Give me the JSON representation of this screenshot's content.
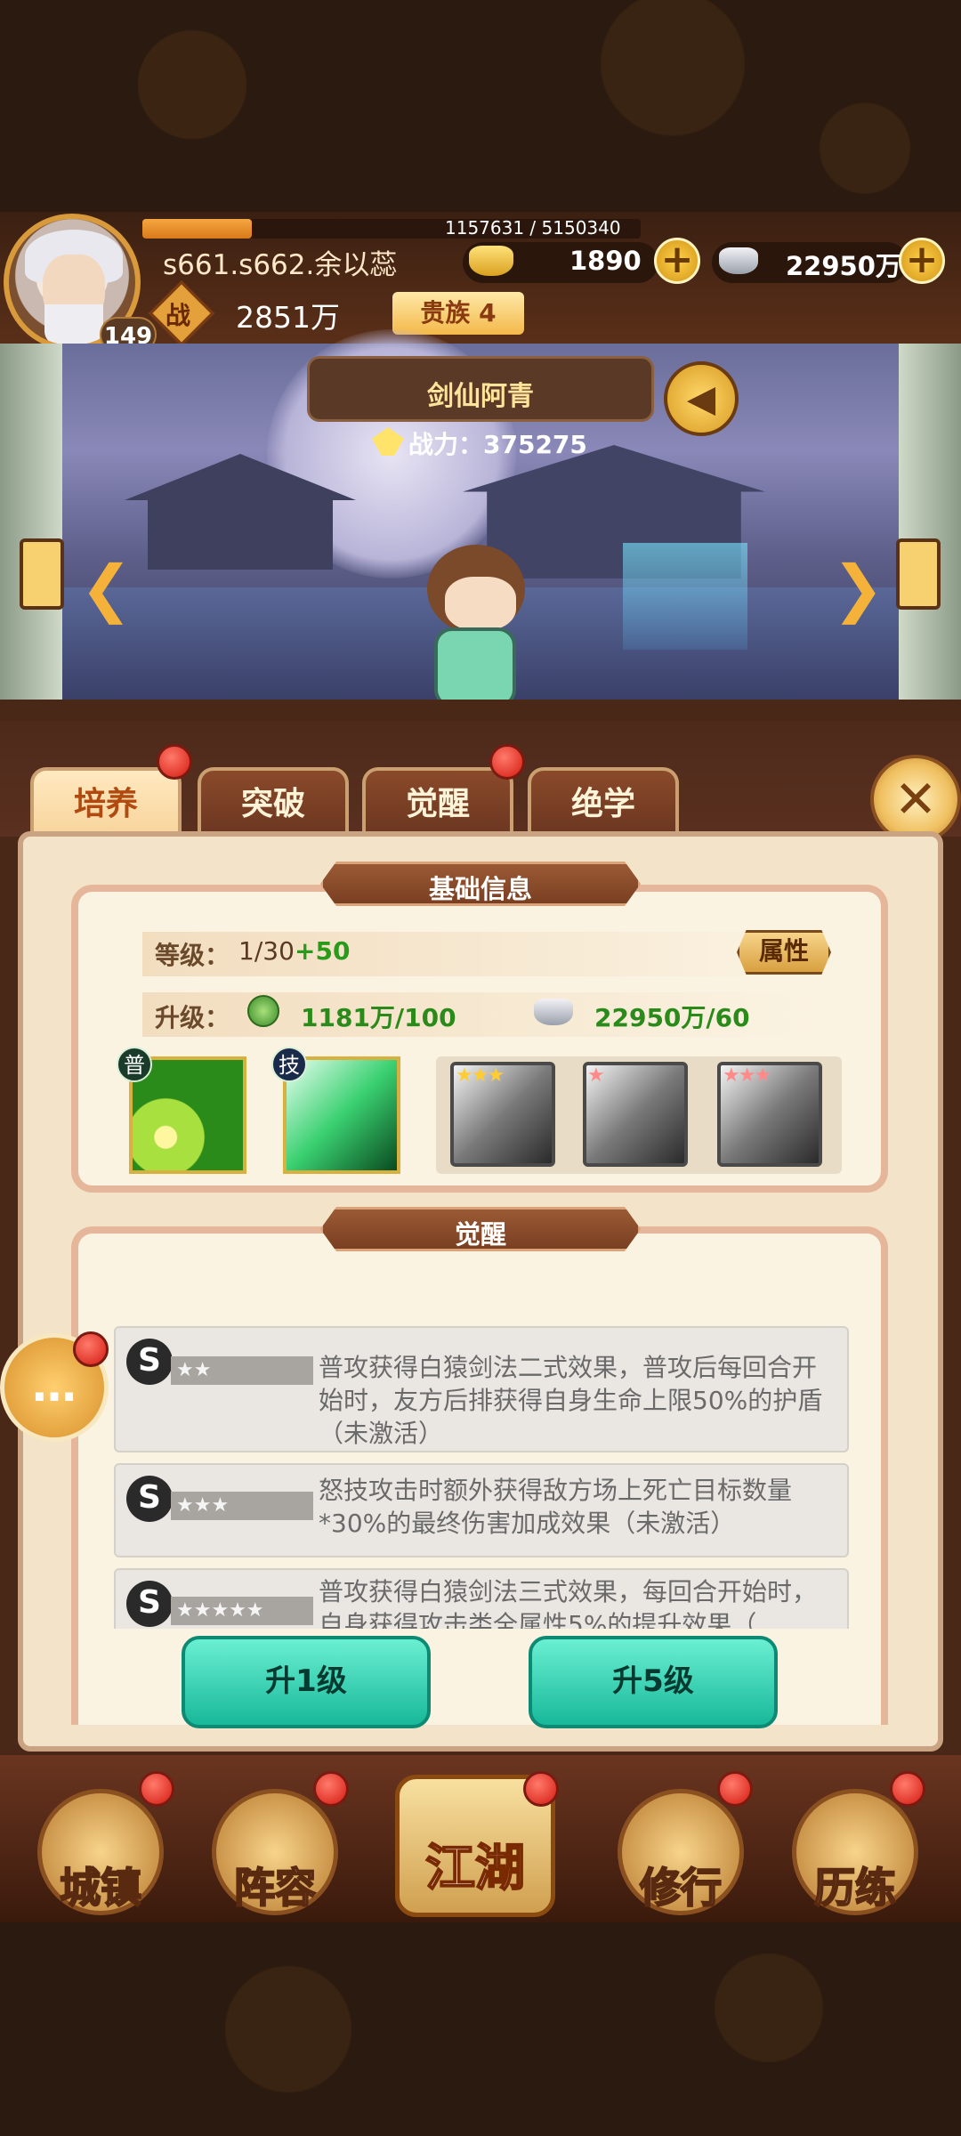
{
  "player": {
    "name": "s661.s662.余以蕊",
    "level": "149",
    "exp_text": "1157631 / 5150340",
    "exp_fraction": 0.22,
    "combat_label": "战",
    "combat_power": "2851万",
    "noble_rank": "贵族 4"
  },
  "currency": {
    "gold": "1890",
    "silver": "22950万",
    "plus": "+"
  },
  "hero": {
    "name": "剑仙阿青",
    "power_text": "战力：375275"
  },
  "tabs": [
    {
      "label": "培养"
    },
    {
      "label": "突破"
    },
    {
      "label": "觉醒"
    },
    {
      "label": "绝学"
    }
  ],
  "basic_info": {
    "title": "基础信息",
    "level_label": "等级：",
    "level_value": "1/30",
    "level_bonus": "+50",
    "attr_button": "属性",
    "upgrade_label": "升级：",
    "exp_requirement": "1181万/100",
    "silver_requirement": "22950万/60",
    "skills": [
      {
        "tag": "普"
      },
      {
        "tag": "技"
      }
    ],
    "locked_skill_stars": [
      "★★★",
      "★",
      "★★★"
    ]
  },
  "awakening": {
    "title": "觉醒",
    "items": [
      {
        "stars": "★★",
        "text": "普攻获得白猿剑法二式效果，普攻后每回合开始时，友方后排获得自身生命上限50%的护盾（未激活）"
      },
      {
        "stars": "★★★",
        "text": "怒技攻击时额外获得敌方场上死亡目标数量*30%的最终伤害加成效果（未激活）"
      },
      {
        "stars": "★★★★★",
        "text": "普攻获得白猿剑法三式效果，每回合开始时，自身获得攻击类全属性5%的提升效果（"
      }
    ]
  },
  "buttons": {
    "up1": "升1级",
    "up5": "升5级"
  },
  "nav": [
    {
      "label": "城镇"
    },
    {
      "label": "阵容"
    },
    {
      "label": "江湖"
    },
    {
      "label": "修行"
    },
    {
      "label": "历练"
    }
  ],
  "colors": {
    "accent_gold": "#f4b23a",
    "bonus_green": "#2a9a1a",
    "button_teal": "#18b89a",
    "badge_red": "#d41a10"
  },
  "icons": {
    "s_badge": "S",
    "arrow_left": "❮",
    "arrow_right": "❯",
    "sound": "◀",
    "close": "✕",
    "chat": "…"
  }
}
